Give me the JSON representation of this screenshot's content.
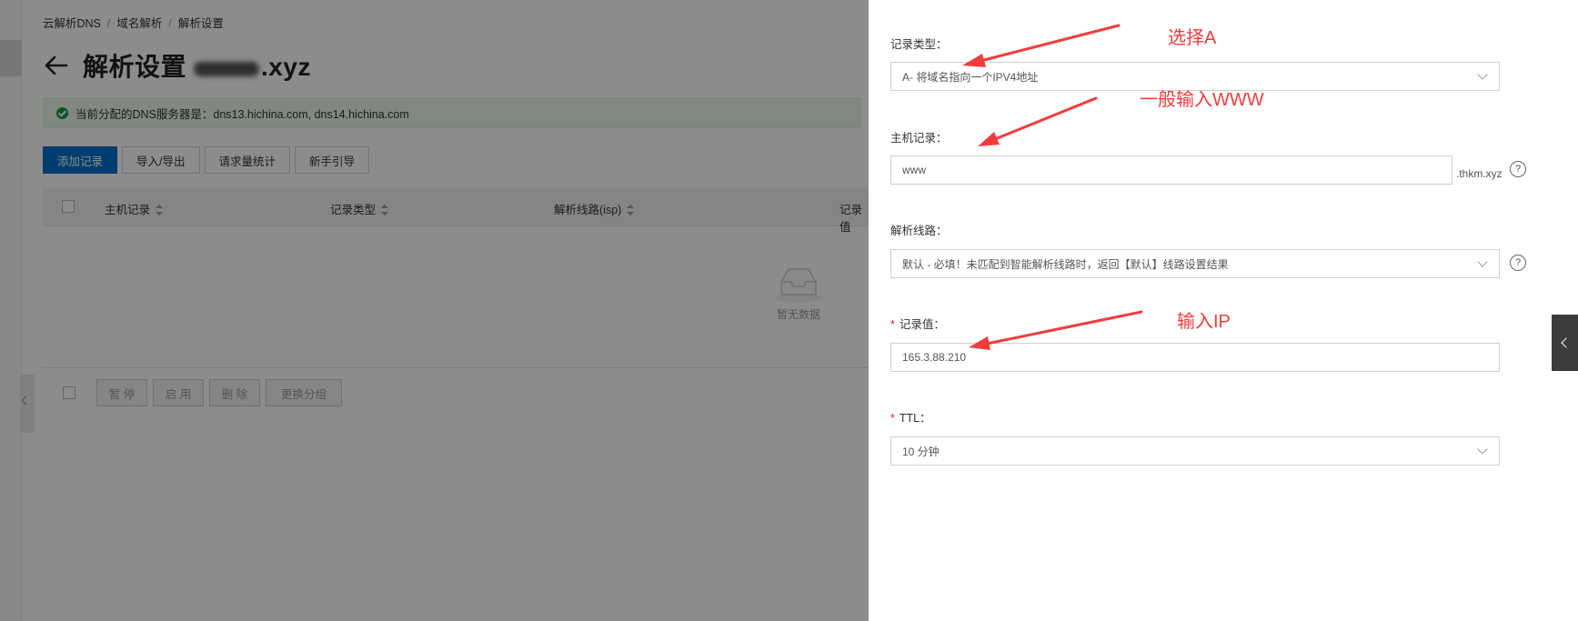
{
  "breadcrumb": {
    "items": [
      "云解析DNS",
      "域名解析",
      "解析设置"
    ],
    "sep": "/"
  },
  "header": {
    "title_prefix": "解析设置",
    "title_suffix": ".xyz"
  },
  "alert": {
    "text": "当前分配的DNS服务器是：dns13.hichina.com, dns14.hichina.com"
  },
  "toolbar": {
    "add": "添加记录",
    "import_export": "导入/导出",
    "stats": "请求量统计",
    "guide": "新手引导"
  },
  "table": {
    "columns": [
      "主机记录",
      "记录类型",
      "解析线路(isp)",
      "记录值"
    ],
    "empty_text": "暂无数据"
  },
  "bulk_actions": [
    "暂 停",
    "启 用",
    "删 除",
    "更换分组"
  ],
  "form": {
    "record_type": {
      "label": "记录类型：",
      "value": "A- 将域名指向一个IPV4地址"
    },
    "host": {
      "label": "主机记录：",
      "value": "www",
      "suffix": ".thkm.xyz"
    },
    "line": {
      "label": "解析线路：",
      "value": "默认 - 必填！未匹配到智能解析线路时，返回【默认】线路设置结果"
    },
    "record_value": {
      "label": "记录值：",
      "value": "165.3.88.210"
    },
    "ttl": {
      "label": "TTL：",
      "value": "10 分钟"
    },
    "help_glyph": "?"
  },
  "annotations": {
    "type": "选择A",
    "host": "一般输入WWW",
    "ip": "输入IP"
  },
  "colors": {
    "primary": "#0070cc",
    "annotation": "#f23c3c",
    "required": "#e02020",
    "success": "#1a9c4c"
  }
}
